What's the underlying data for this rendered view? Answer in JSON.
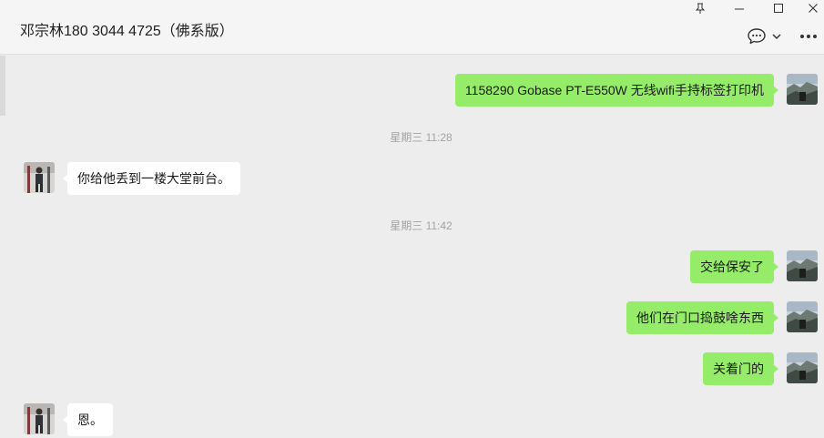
{
  "header": {
    "title": "邓宗林180 3044 4725（佛系版）",
    "icons": {
      "pin": "pin-icon",
      "minimize": "minimize-icon",
      "maximize": "maximize-icon",
      "close": "close-icon",
      "chat_tools": "chat-bubble-icon",
      "more": "more-icon"
    }
  },
  "messages": [
    {
      "from": "me",
      "text": "1158290 Gobase PT-E550W 无线wifi手持标签打印机"
    },
    {
      "type": "time",
      "text": "星期三 11:28"
    },
    {
      "from": "them",
      "text": "你给他丢到一楼大堂前台。"
    },
    {
      "type": "time",
      "text": "星期三 11:42"
    },
    {
      "from": "me",
      "text": "交给保安了"
    },
    {
      "from": "me",
      "text": "他们在门口捣鼓啥东西"
    },
    {
      "from": "me",
      "text": "关着门的"
    },
    {
      "from": "them",
      "text": "恩。"
    }
  ],
  "colors": {
    "my_bubble": "#95ec69",
    "their_bubble": "#ffffff",
    "background": "#ededed",
    "header": "#f5f5f5"
  }
}
